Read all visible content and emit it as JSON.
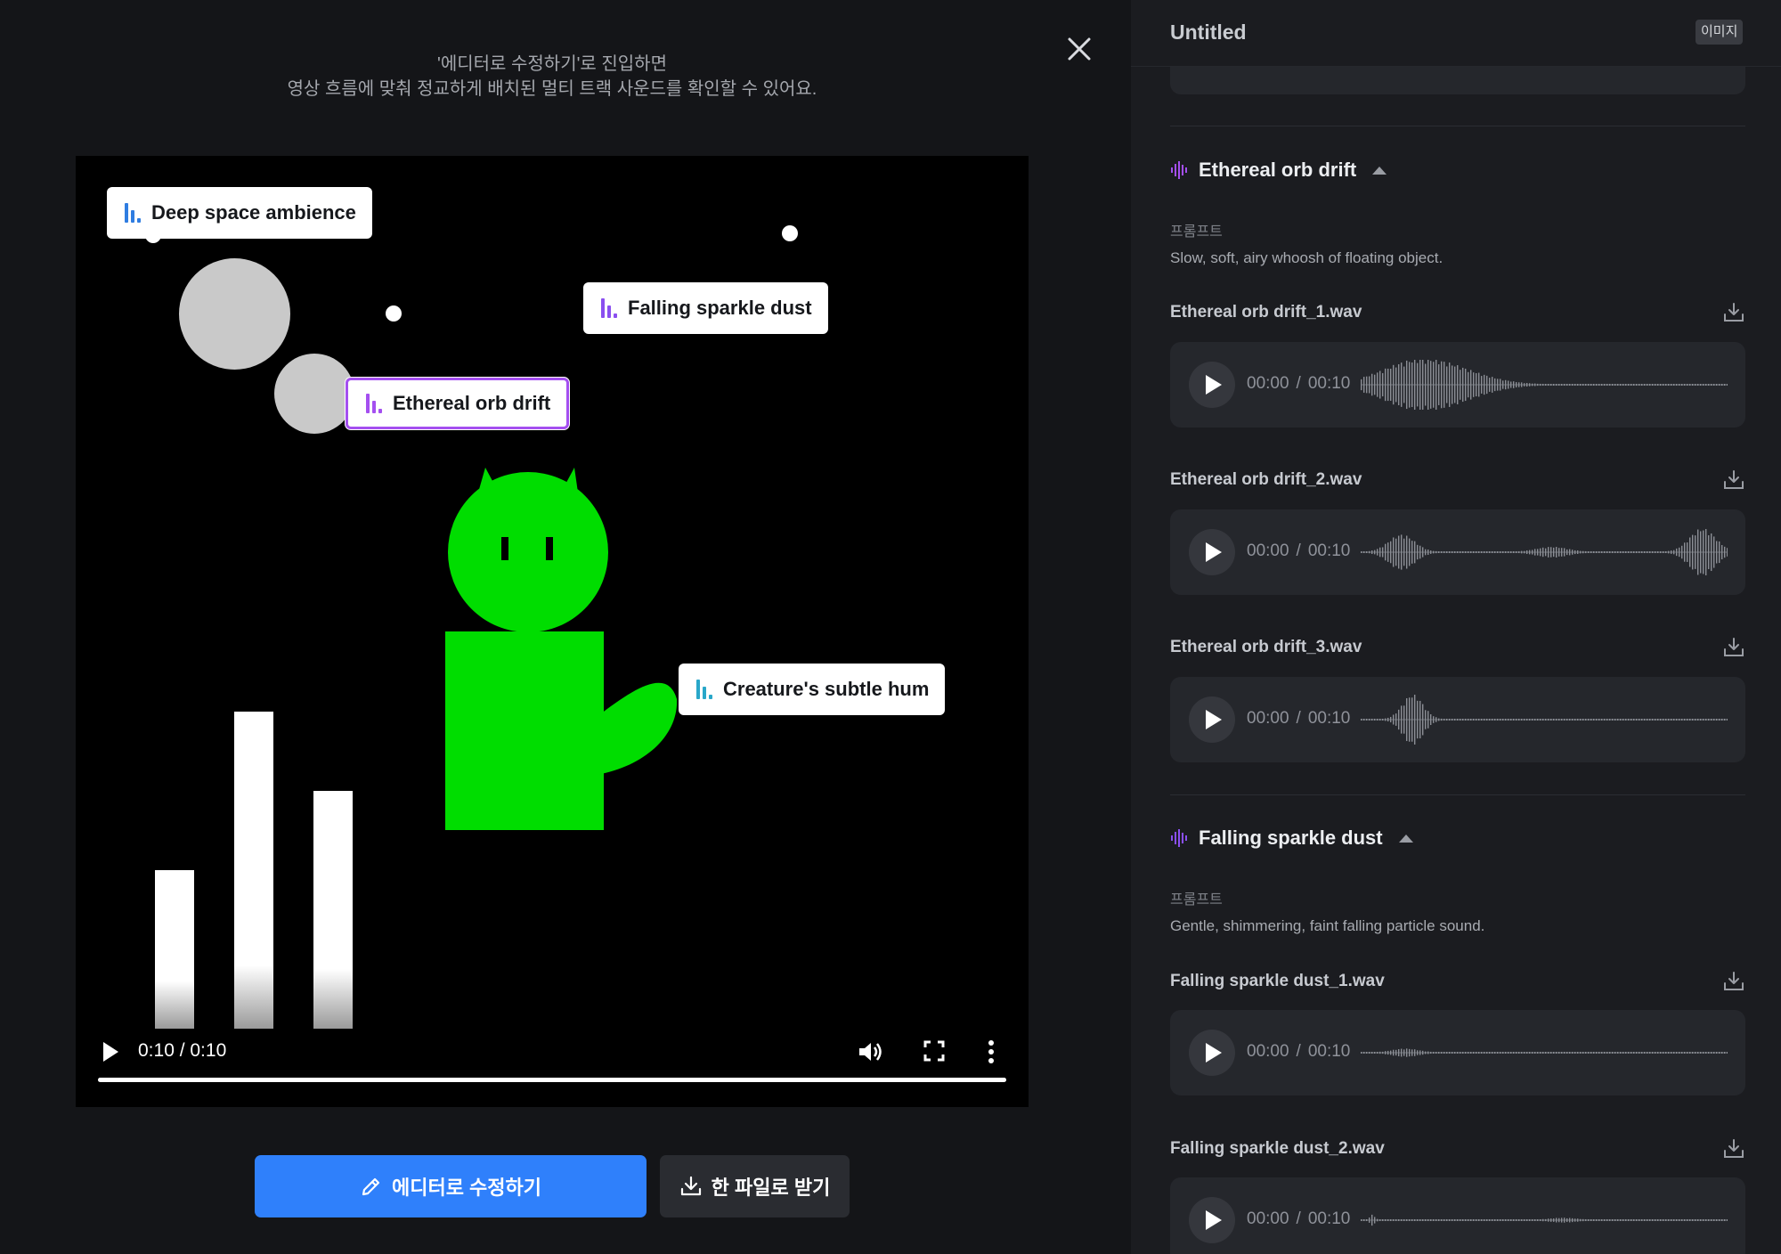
{
  "intro": {
    "line1": "'에디터로 수정하기'로 진입하면",
    "line2": "영상 흐름에 맞춰 정교하게 배치된 멀티 트랙 사운드를 확인할 수 있어요."
  },
  "video": {
    "tags": [
      {
        "label": "Deep space ambience",
        "color": "#2f7de1"
      },
      {
        "label": "Falling sparkle dust",
        "color": "#8a4ff0"
      },
      {
        "label": "Ethereal orb drift",
        "color": "#a44ff0"
      },
      {
        "label": "Creature's subtle hum",
        "color": "#29a7c9"
      }
    ],
    "controls": {
      "time": "0:10 / 0:10",
      "progress": 1.0
    }
  },
  "actions": {
    "edit_label": "에디터로 수정하기",
    "download_label": "한 파일로 받기"
  },
  "panel": {
    "title": "Untitled",
    "badge": "이미지",
    "sections": [
      {
        "title": "Ethereal orb drift",
        "icon_color": "#a44ff0",
        "prompt_label": "프롬프트",
        "prompt": "Slow, soft, airy whoosh of floating object.",
        "files": [
          {
            "name": "Ethereal orb drift_1.wav",
            "current": "00:00",
            "sep": "/",
            "duration": "00:10"
          },
          {
            "name": "Ethereal orb drift_2.wav",
            "current": "00:00",
            "sep": "/",
            "duration": "00:10"
          },
          {
            "name": "Ethereal orb drift_3.wav",
            "current": "00:00",
            "sep": "/",
            "duration": "00:10"
          }
        ]
      },
      {
        "title": "Falling sparkle dust",
        "icon_color": "#8a4ff0",
        "prompt_label": "프롬프트",
        "prompt": "Gentle, shimmering, faint falling particle sound.",
        "files": [
          {
            "name": "Falling sparkle dust_1.wav",
            "current": "00:00",
            "sep": "/",
            "duration": "00:10"
          },
          {
            "name": "Falling sparkle dust_2.wav",
            "current": "00:00",
            "sep": "/",
            "duration": "00:10"
          }
        ]
      }
    ]
  },
  "colors": {
    "accent": "#2f80fb",
    "creature": "#00dd00",
    "panel_bg": "#1b1c20",
    "waveform": "#8c8f96"
  },
  "icons": [
    "close-icon",
    "audio-track-icon",
    "play-icon",
    "volume-icon",
    "fullscreen-icon",
    "more-vertical-icon",
    "pencil-icon",
    "download-icon",
    "waveform-icon",
    "caret-up-icon"
  ]
}
